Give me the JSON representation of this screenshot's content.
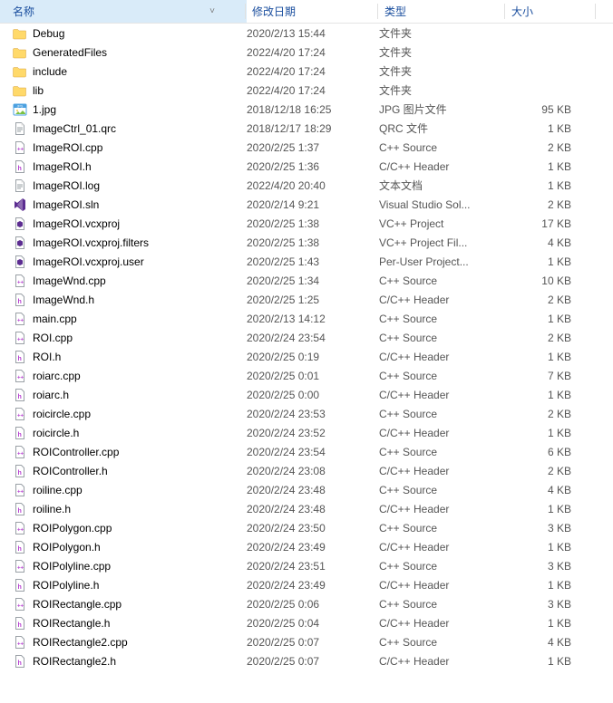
{
  "columns": {
    "name": "名称",
    "date": "修改日期",
    "type": "类型",
    "size": "大小"
  },
  "files": [
    {
      "icon": "folder",
      "name": "Debug",
      "date": "2020/2/13 15:44",
      "type": "文件夹",
      "size": ""
    },
    {
      "icon": "folder",
      "name": "GeneratedFiles",
      "date": "2022/4/20 17:24",
      "type": "文件夹",
      "size": ""
    },
    {
      "icon": "folder",
      "name": "include",
      "date": "2022/4/20 17:24",
      "type": "文件夹",
      "size": ""
    },
    {
      "icon": "folder",
      "name": "lib",
      "date": "2022/4/20 17:24",
      "type": "文件夹",
      "size": ""
    },
    {
      "icon": "jpg",
      "name": "1.jpg",
      "date": "2018/12/18 16:25",
      "type": "JPG 图片文件",
      "size": "95 KB"
    },
    {
      "icon": "text",
      "name": "ImageCtrl_01.qrc",
      "date": "2018/12/17 18:29",
      "type": "QRC 文件",
      "size": "1 KB"
    },
    {
      "icon": "cpp",
      "name": "ImageROI.cpp",
      "date": "2020/2/25 1:37",
      "type": "C++ Source",
      "size": "2 KB"
    },
    {
      "icon": "h",
      "name": "ImageROI.h",
      "date": "2020/2/25 1:36",
      "type": "C/C++ Header",
      "size": "1 KB"
    },
    {
      "icon": "text",
      "name": "ImageROI.log",
      "date": "2022/4/20 20:40",
      "type": "文本文档",
      "size": "1 KB"
    },
    {
      "icon": "sln",
      "name": "ImageROI.sln",
      "date": "2020/2/14 9:21",
      "type": "Visual Studio Sol...",
      "size": "2 KB"
    },
    {
      "icon": "vcx",
      "name": "ImageROI.vcxproj",
      "date": "2020/2/25 1:38",
      "type": "VC++ Project",
      "size": "17 KB"
    },
    {
      "icon": "vcx",
      "name": "ImageROI.vcxproj.filters",
      "date": "2020/2/25 1:38",
      "type": "VC++ Project Fil...",
      "size": "4 KB"
    },
    {
      "icon": "vcx",
      "name": "ImageROI.vcxproj.user",
      "date": "2020/2/25 1:43",
      "type": "Per-User Project...",
      "size": "1 KB"
    },
    {
      "icon": "cpp",
      "name": "ImageWnd.cpp",
      "date": "2020/2/25 1:34",
      "type": "C++ Source",
      "size": "10 KB"
    },
    {
      "icon": "h",
      "name": "ImageWnd.h",
      "date": "2020/2/25 1:25",
      "type": "C/C++ Header",
      "size": "2 KB"
    },
    {
      "icon": "cpp",
      "name": "main.cpp",
      "date": "2020/2/13 14:12",
      "type": "C++ Source",
      "size": "1 KB"
    },
    {
      "icon": "cpp",
      "name": "ROI.cpp",
      "date": "2020/2/24 23:54",
      "type": "C++ Source",
      "size": "2 KB"
    },
    {
      "icon": "h",
      "name": "ROI.h",
      "date": "2020/2/25 0:19",
      "type": "C/C++ Header",
      "size": "1 KB"
    },
    {
      "icon": "cpp",
      "name": "roiarc.cpp",
      "date": "2020/2/25 0:01",
      "type": "C++ Source",
      "size": "7 KB"
    },
    {
      "icon": "h",
      "name": "roiarc.h",
      "date": "2020/2/25 0:00",
      "type": "C/C++ Header",
      "size": "1 KB"
    },
    {
      "icon": "cpp",
      "name": "roicircle.cpp",
      "date": "2020/2/24 23:53",
      "type": "C++ Source",
      "size": "2 KB"
    },
    {
      "icon": "h",
      "name": "roicircle.h",
      "date": "2020/2/24 23:52",
      "type": "C/C++ Header",
      "size": "1 KB"
    },
    {
      "icon": "cpp",
      "name": "ROIController.cpp",
      "date": "2020/2/24 23:54",
      "type": "C++ Source",
      "size": "6 KB"
    },
    {
      "icon": "h",
      "name": "ROIController.h",
      "date": "2020/2/24 23:08",
      "type": "C/C++ Header",
      "size": "2 KB"
    },
    {
      "icon": "cpp",
      "name": "roiline.cpp",
      "date": "2020/2/24 23:48",
      "type": "C++ Source",
      "size": "4 KB"
    },
    {
      "icon": "h",
      "name": "roiline.h",
      "date": "2020/2/24 23:48",
      "type": "C/C++ Header",
      "size": "1 KB"
    },
    {
      "icon": "cpp",
      "name": "ROIPolygon.cpp",
      "date": "2020/2/24 23:50",
      "type": "C++ Source",
      "size": "3 KB"
    },
    {
      "icon": "h",
      "name": "ROIPolygon.h",
      "date": "2020/2/24 23:49",
      "type": "C/C++ Header",
      "size": "1 KB"
    },
    {
      "icon": "cpp",
      "name": "ROIPolyline.cpp",
      "date": "2020/2/24 23:51",
      "type": "C++ Source",
      "size": "3 KB"
    },
    {
      "icon": "h",
      "name": "ROIPolyline.h",
      "date": "2020/2/24 23:49",
      "type": "C/C++ Header",
      "size": "1 KB"
    },
    {
      "icon": "cpp",
      "name": "ROIRectangle.cpp",
      "date": "2020/2/25 0:06",
      "type": "C++ Source",
      "size": "3 KB"
    },
    {
      "icon": "h",
      "name": "ROIRectangle.h",
      "date": "2020/2/25 0:04",
      "type": "C/C++ Header",
      "size": "1 KB"
    },
    {
      "icon": "cpp",
      "name": "ROIRectangle2.cpp",
      "date": "2020/2/25 0:07",
      "type": "C++ Source",
      "size": "4 KB"
    },
    {
      "icon": "h",
      "name": "ROIRectangle2.h",
      "date": "2020/2/25 0:07",
      "type": "C/C++ Header",
      "size": "1 KB"
    }
  ]
}
